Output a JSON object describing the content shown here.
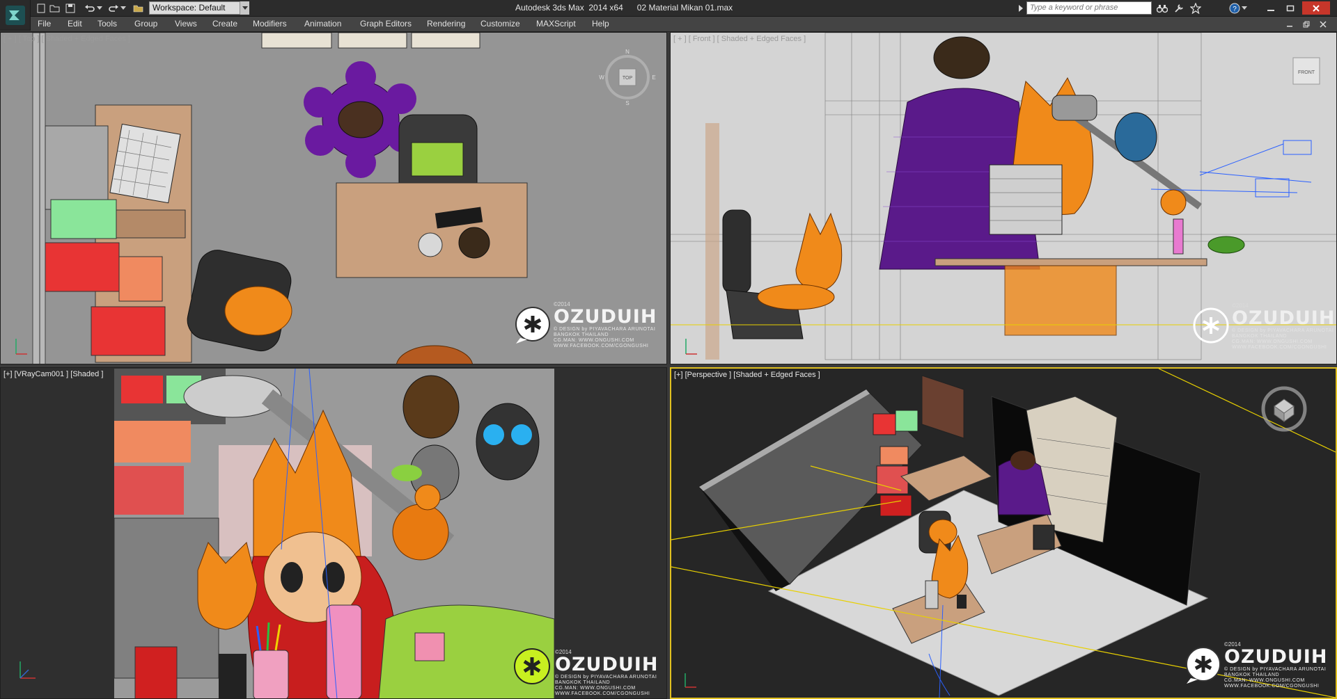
{
  "app": {
    "logo_icon": "3ds-max-logo-icon",
    "workspace_label": "Workspace: Default",
    "window_title": "Autodesk 3ds Max  2014 x64      02 Material Mikan 01.max",
    "search_placeholder": "Type a keyword or phrase"
  },
  "quick_access": [
    "new-file-icon",
    "open-file-icon",
    "save-file-icon",
    "undo-icon",
    "redo-icon"
  ],
  "toolbar_icons": [
    "binoculars-icon",
    "tools-icon",
    "star-icon",
    "help-icon"
  ],
  "menu": {
    "items": [
      "File",
      "Edit",
      "Tools",
      "Group",
      "Views",
      "Create",
      "Modifiers",
      "Animation",
      "Graph Editors",
      "Rendering",
      "Customize",
      "MAXScript",
      "Help"
    ]
  },
  "viewports": {
    "top": {
      "label": "[ + ] [ Top ] [ Shaded + Edged Faces ]",
      "viewcube": "TOP",
      "viewcube_letters": [
        "N",
        "E",
        "S",
        "W"
      ]
    },
    "front": {
      "label": "[ + ] [ Front ] [ Shaded + Edged Faces ]",
      "viewcube": "FRONT"
    },
    "camera": {
      "label": "[+] [VRayCam001 ] [Shaded ]"
    },
    "perspective": {
      "label": "[+] [Perspective ] [Shaded + Edged Faces ]"
    }
  },
  "watermark": {
    "year": "©2014",
    "title": "OZUDUIH",
    "lines": [
      "© DESIGN by PIYAVACHARA ARUNOTAI",
      "BANGKOK    THAILAND",
      "CG.MAN: WWW.ONGUSHI.COM",
      "WWW.FACEBOOK.COM/CGONGUSHI"
    ]
  },
  "colors": {
    "active_border": "#e0c020",
    "title_bg": "#2c2c2c",
    "menu_bg": "#444444",
    "top_bg": "#959595",
    "front_bg": "#d4d4d4"
  }
}
